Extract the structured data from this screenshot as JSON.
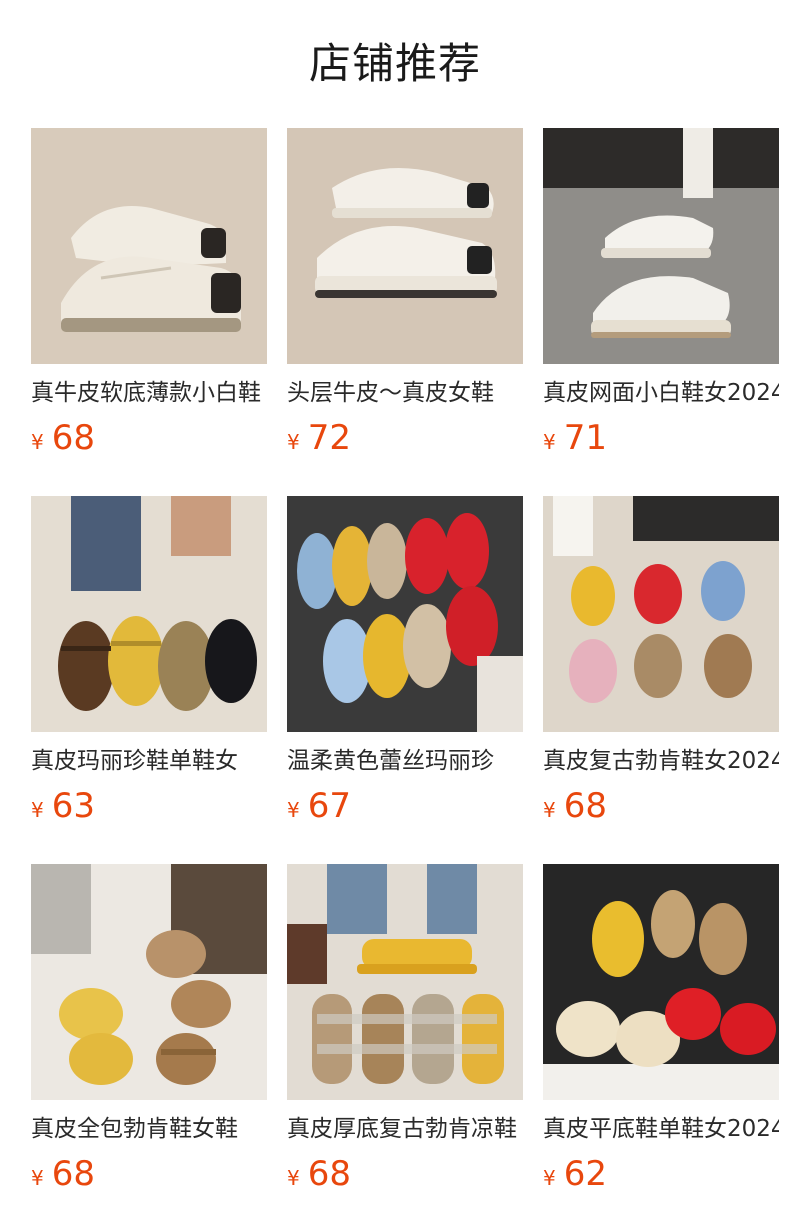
{
  "header": {
    "title": "店铺推荐"
  },
  "products": [
    {
      "name": "真牛皮软底薄款小白鞋",
      "currency": "¥",
      "price": "68",
      "image": "beige-sneakers-icon"
    },
    {
      "name": "头层牛皮～真皮女鞋",
      "currency": "¥",
      "price": "72",
      "image": "white-platform-sneakers-icon"
    },
    {
      "name": "真皮网面小白鞋女2024",
      "currency": "¥",
      "price": "71",
      "image": "mesh-sneaker-on-foot-icon"
    },
    {
      "name": "真皮玛丽珍鞋单鞋女",
      "currency": "¥",
      "price": "63",
      "image": "mary-jane-flats-icon"
    },
    {
      "name": "温柔黄色蕾丝玛丽珍",
      "currency": "¥",
      "price": "67",
      "image": "lace-mary-jane-icon"
    },
    {
      "name": "真皮复古勃肯鞋女2024",
      "currency": "¥",
      "price": "68",
      "image": "suede-mary-jane-icon"
    },
    {
      "name": "真皮全包勃肯鞋女鞋",
      "currency": "¥",
      "price": "68",
      "image": "suede-clogs-icon"
    },
    {
      "name": "真皮厚底复古勃肯凉鞋",
      "currency": "¥",
      "price": "68",
      "image": "buckle-sandals-icon"
    },
    {
      "name": "真皮平底鞋单鞋女2024",
      "currency": "¥",
      "price": "62",
      "image": "bow-ballet-flats-icon"
    }
  ]
}
